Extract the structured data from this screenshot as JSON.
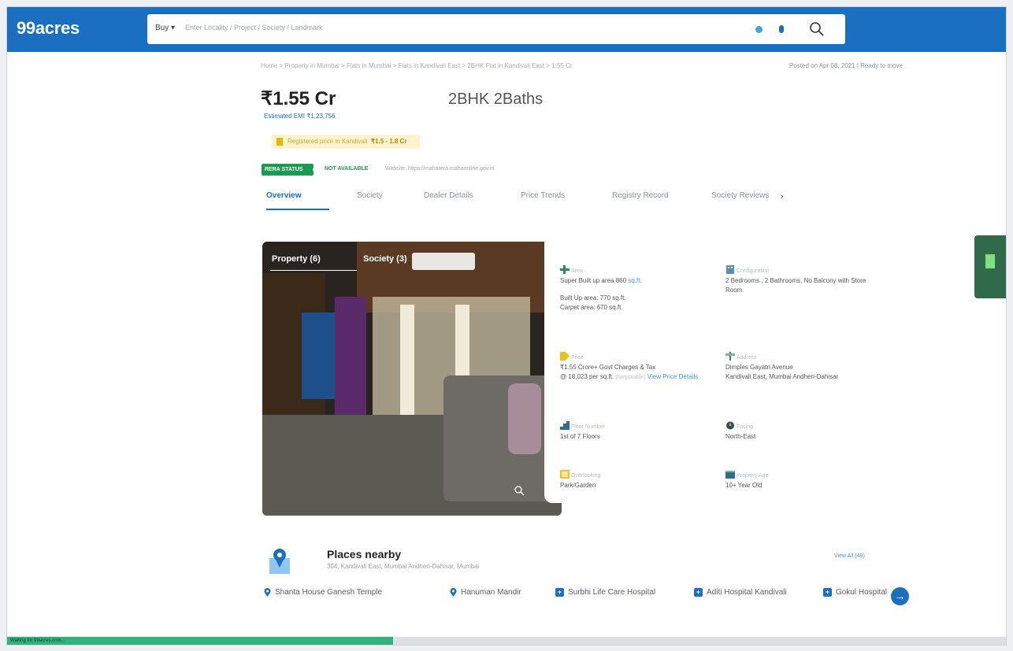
{
  "header": {
    "logo": "99acres",
    "buy_label": "Buy ▾",
    "search_placeholder": "Enter Locality / Project / Society / Landmark"
  },
  "breadcrumb": "Home > Property in Mumbai > Flats in Mumbai > Flats in Kandivali East > 2BHK Flat in Kandivali East > 1.55 Cr",
  "posted": "Posted on Apr 08, 2021 | Ready to move",
  "property": {
    "price": "₹1.55 Cr",
    "emi": "Estimated EMI ₹1,23,756",
    "config": "2BHK 2Baths",
    "highlight_text": "Registered price in Kandivali",
    "highlight_range": "₹1.5 - 1.8 Cr"
  },
  "rera": {
    "badge": "RERA STATUS",
    "status": "NOT AVAILABLE",
    "website": "Website: https://maharera.mahaonline.gov.in"
  },
  "tabs": [
    "Overview",
    "Society",
    "Dealer Details",
    "Price Trends",
    "Registry Record",
    "Society Reviews"
  ],
  "gallery": {
    "tab_property": "Property (6)",
    "tab_society": "Society (3)"
  },
  "details": {
    "area_label": "Area",
    "super_built": "Super Built up area 860",
    "super_unit": "sq.ft.",
    "built_up": "Built Up area: 770 sq.ft.",
    "carpet": "Carpet area: 670 sq.ft.",
    "config_label": "Configuration",
    "config_value": "2 Bedrooms , 2 Bathrooms, No Balcony with Store Room",
    "price_label": "Price",
    "price_value": "₹1.55 Crore+ Govt Charges & Tax",
    "price_sqft": "@ 18,023 per sq.ft.",
    "price_neg": "(Negotiable)",
    "price_link": "View Price Details",
    "address_label": "Address",
    "address_l1": "Dimples Gayatri Avenue",
    "address_l2": "Kandivali East, Mumbai Andheri-Dahisar",
    "floor_label": "Floor Number",
    "floor_value": "1st of 7 Floors",
    "facing_label": "Facing",
    "facing_value": "North-East",
    "overlook_label": "Overlooking",
    "overlook_value": "Park/Garden",
    "age_label": "Property Age",
    "age_value": "10+ Year Old"
  },
  "places": {
    "title": "Places nearby",
    "subtitle": "304, Kandivali East, Mumbai Andheri-Dahisar, Mumbai",
    "view_all": "View All (49)",
    "chips": [
      {
        "name": "Shanta House Ganesh Temple",
        "type": "pin"
      },
      {
        "name": "Hanuman Mandir",
        "type": "pin"
      },
      {
        "name": "Surbhi Life Care Hospital",
        "type": "hospital"
      },
      {
        "name": "Aditi Hospital Kandivali",
        "type": "hospital"
      },
      {
        "name": "Gokul Hospital",
        "type": "hospital"
      }
    ]
  },
  "statusbar": "Waiting for 99acres.com...",
  "colors": {
    "brand": "#1a6fc0",
    "rera_green": "#1a9b52",
    "side_badge": "#2f6b4a"
  }
}
